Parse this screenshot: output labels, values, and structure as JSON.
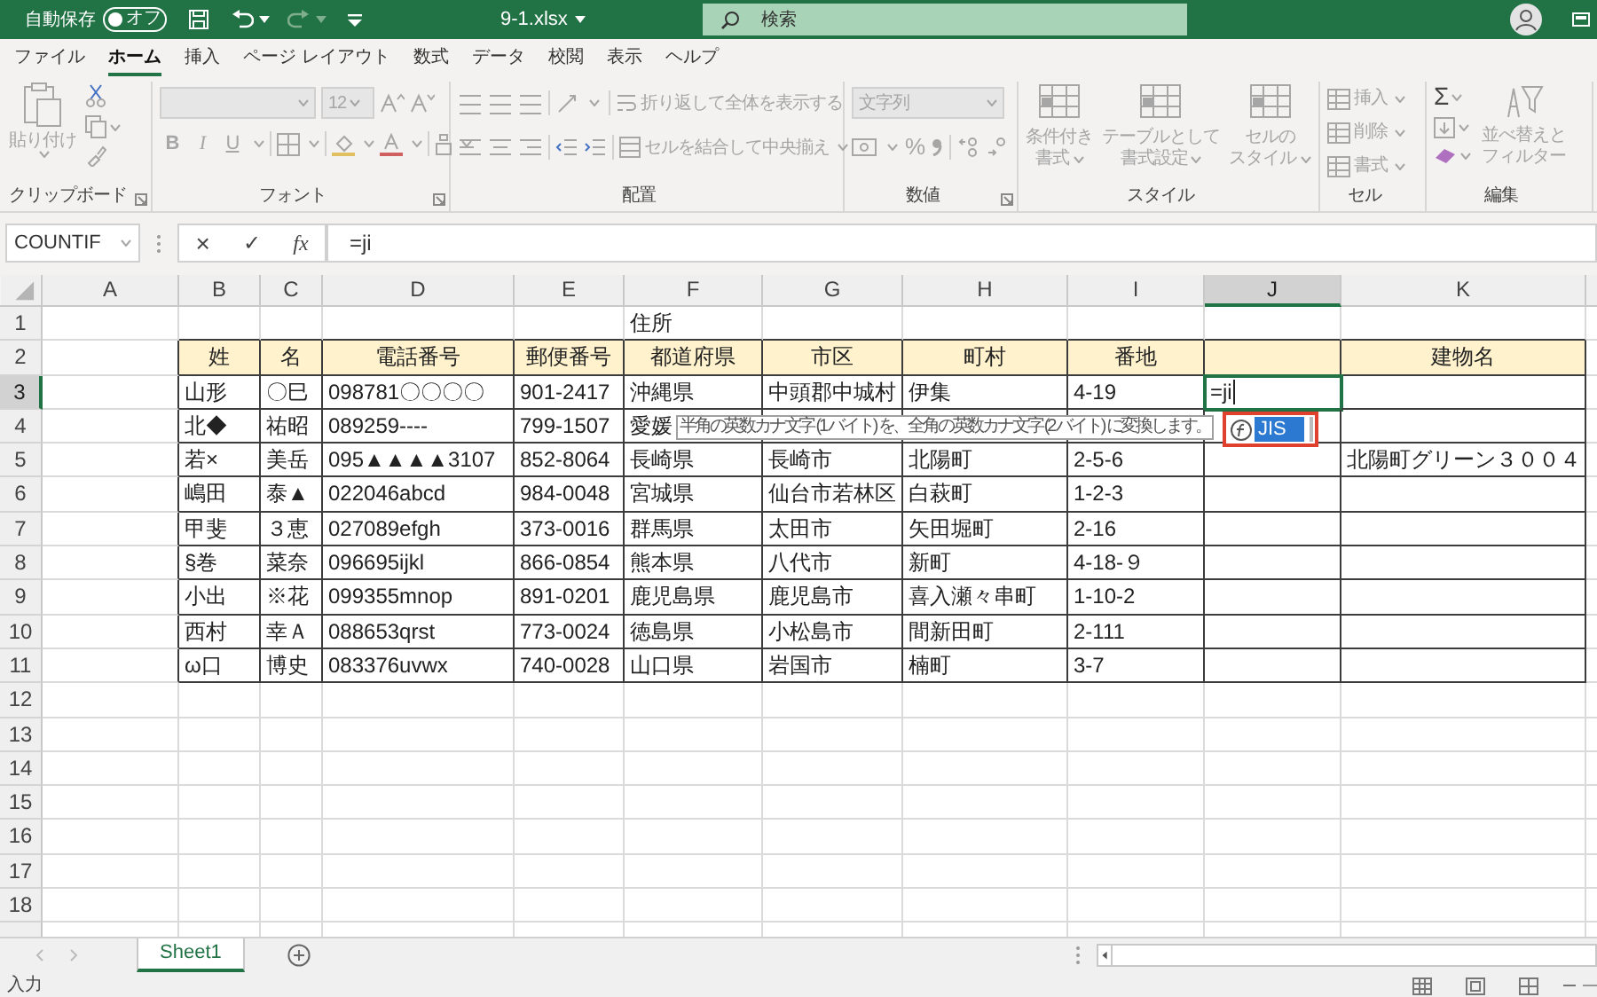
{
  "title_bar": {
    "autosave_label": "自動保存",
    "autosave_state": "オフ",
    "autosave_on": false,
    "file_name": "9-1.xlsx",
    "search_placeholder": "検索"
  },
  "ribbon_tabs": [
    {
      "label": "ファイル",
      "selected": false
    },
    {
      "label": "ホーム",
      "selected": true
    },
    {
      "label": "挿入",
      "selected": false
    },
    {
      "label": "ページ レイアウト",
      "selected": false
    },
    {
      "label": "数式",
      "selected": false
    },
    {
      "label": "データ",
      "selected": false
    },
    {
      "label": "校閲",
      "selected": false
    },
    {
      "label": "表示",
      "selected": false
    },
    {
      "label": "ヘルプ",
      "selected": false
    }
  ],
  "ribbon": {
    "disabled": true,
    "groups": [
      {
        "kind": "clipboard",
        "label": "クリップボード",
        "paste": "貼り付け"
      },
      {
        "kind": "font",
        "label": "フォント",
        "font_size": "12",
        "format_buttons": [
          {
            "kind": "bold",
            "label": "B"
          },
          {
            "kind": "italic",
            "label": "I"
          },
          {
            "kind": "underline",
            "label": "U"
          }
        ]
      },
      {
        "kind": "alignment",
        "label": "配置",
        "wrap_text": "折り返して全体を表示する",
        "merge": "セルを結合して中央揃え"
      },
      {
        "kind": "number",
        "label": "数値",
        "format": "文字列",
        "percent": "%"
      },
      {
        "kind": "styles",
        "label": "スタイル",
        "buttons": [
          {
            "lines": [
              "条件付き",
              "書式"
            ]
          },
          {
            "lines": [
              "テーブルとして",
              "書式設定"
            ]
          },
          {
            "lines": [
              "セルの",
              "スタイル"
            ]
          }
        ]
      },
      {
        "kind": "cells",
        "label": "セル",
        "buttons": [
          "挿入",
          "削除",
          "書式"
        ]
      },
      {
        "kind": "editing",
        "label": "編集",
        "autosum": "Σ",
        "sort_filter": [
          "並べ替えと",
          "フィルター"
        ]
      }
    ]
  },
  "formula_bar": {
    "name_box": "COUNTIF",
    "cancel": "×",
    "enter": "✓",
    "insert_function": "fx",
    "formula": "=ji"
  },
  "columns": [
    {
      "letter": "A",
      "selected": false
    },
    {
      "letter": "B",
      "selected": false
    },
    {
      "letter": "C",
      "selected": false
    },
    {
      "letter": "D",
      "selected": false
    },
    {
      "letter": "E",
      "selected": false
    },
    {
      "letter": "F",
      "selected": false
    },
    {
      "letter": "G",
      "selected": false
    },
    {
      "letter": "H",
      "selected": false
    },
    {
      "letter": "I",
      "selected": false
    },
    {
      "letter": "J",
      "selected": true
    },
    {
      "letter": "K",
      "selected": false
    }
  ],
  "rows": [
    {
      "number": "1",
      "selected": false,
      "kind": "plain",
      "cells": {
        "F": "住所"
      }
    },
    {
      "number": "2",
      "selected": false,
      "kind": "header",
      "cells": {
        "B": "姓",
        "C": "名",
        "D": "電話番号",
        "E": "郵便番号",
        "F": "都道府県",
        "G": "市区",
        "H": "町村",
        "I": "番地",
        "K": "建物名"
      }
    },
    {
      "number": "3",
      "selected": true,
      "kind": "data",
      "cells": {
        "B": "山形",
        "C": "〇巳",
        "D": "098781〇〇〇〇",
        "E": "901-2417",
        "F": "沖縄県",
        "G": "中頭郡中城村",
        "H": "伊集",
        "I": "4-19",
        "J": "=ji"
      }
    },
    {
      "number": "4",
      "selected": false,
      "kind": "data",
      "cells": {
        "B": "北◆",
        "C": "祐昭",
        "D": "089259----",
        "E": "799-1507",
        "F": "愛媛"
      }
    },
    {
      "number": "5",
      "selected": false,
      "kind": "data",
      "cells": {
        "B": "若×",
        "C": "美岳",
        "D": "095▲▲▲▲3107",
        "E": "852-8064",
        "F": "長崎県",
        "G": "長崎市",
        "H": "北陽町",
        "I": "2-5-6",
        "K": "北陽町グリーン３００４"
      }
    },
    {
      "number": "6",
      "selected": false,
      "kind": "data",
      "cells": {
        "B": "嶋田",
        "C": "泰▲",
        "D": "022046abcd",
        "E": "984-0048",
        "F": "宮城県",
        "G": "仙台市若林区",
        "H": "白萩町",
        "I": "1-2-3"
      }
    },
    {
      "number": "7",
      "selected": false,
      "kind": "data",
      "cells": {
        "B": "甲斐",
        "C": "３恵",
        "D": "027089efgh",
        "E": "373-0016",
        "F": "群馬県",
        "G": "太田市",
        "H": "矢田堀町",
        "I": "2-16"
      }
    },
    {
      "number": "8",
      "selected": false,
      "kind": "data",
      "cells": {
        "B": "§巻",
        "C": "菜奈",
        "D": "096695ijkl",
        "E": "866-0854",
        "F": "熊本県",
        "G": "八代市",
        "H": "新町",
        "I": "4-18-９"
      }
    },
    {
      "number": "9",
      "selected": false,
      "kind": "data",
      "cells": {
        "B": "小出",
        "C": "※花",
        "D": "099355mnop",
        "E": "891-0201",
        "F": "鹿児島県",
        "G": "鹿児島市",
        "H": "喜入瀬々串町",
        "I": "1-10-2"
      }
    },
    {
      "number": "10",
      "selected": false,
      "kind": "data",
      "cells": {
        "B": "西村",
        "C": "幸Ａ",
        "D": "088653qrst",
        "E": "773-0024",
        "F": "徳島県",
        "G": "小松島市",
        "H": "間新田町",
        "I": "2-111"
      }
    },
    {
      "number": "11",
      "selected": false,
      "kind": "data",
      "cells": {
        "B": "ω口",
        "C": "博史",
        "D": "083376uvwx",
        "E": "740-0028",
        "F": "山口県",
        "G": "岩国市",
        "H": "楠町",
        "I": "3-7"
      }
    },
    {
      "number": "12",
      "selected": false,
      "kind": "plain"
    },
    {
      "number": "13",
      "selected": false,
      "kind": "plain"
    },
    {
      "number": "14",
      "selected": false,
      "kind": "plain"
    },
    {
      "number": "15",
      "selected": false,
      "kind": "plain"
    },
    {
      "number": "16",
      "selected": false,
      "kind": "plain"
    },
    {
      "number": "17",
      "selected": false,
      "kind": "plain"
    },
    {
      "number": "18",
      "selected": false,
      "kind": "plain"
    }
  ],
  "tooltip": {
    "text": "半角の英数カナ文字 (1 バイト) を、全角の英数カナ文字 (2 バイト) に変換します。"
  },
  "autocomplete": {
    "items": [
      {
        "label": "JIS",
        "selected": true
      }
    ]
  },
  "sheet_tabs": [
    {
      "label": "Sheet1",
      "selected": true
    }
  ],
  "status_bar": {
    "mode": "入力"
  }
}
